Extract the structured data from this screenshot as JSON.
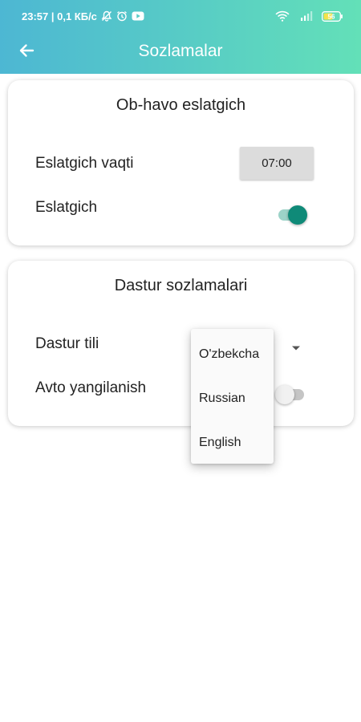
{
  "status_bar": {
    "time_speed": "23:57 | 0,1 КБ/с",
    "battery_level": "56",
    "icons": [
      "mute-bell-icon",
      "alarm-icon",
      "youtube-icon",
      "wifi-icon",
      "signal-icon",
      "battery-icon"
    ]
  },
  "app_bar": {
    "title": "Sozlamalar",
    "back_icon": "arrow-left-icon",
    "gradient_colors": [
      "#4db7d3",
      "#63e0b8"
    ]
  },
  "weather_card": {
    "title": "Ob-havo eslatgich",
    "reminder_time_label": "Eslatgich vaqti",
    "reminder_time_value": "07:00",
    "reminder_label": "Eslatgich",
    "reminder_enabled": true
  },
  "app_settings_card": {
    "title": "Dastur sozlamalari",
    "language_label": "Dastur tili",
    "auto_update_label": "Avto yangilanish",
    "auto_update_enabled": false
  },
  "language_menu": {
    "options": [
      "O'zbekcha",
      "Russian",
      "English"
    ]
  },
  "colors": {
    "switch_on": "#0f8a78",
    "switch_on_track": "#9cd3c8",
    "switch_off_track": "#c5c5c5"
  }
}
